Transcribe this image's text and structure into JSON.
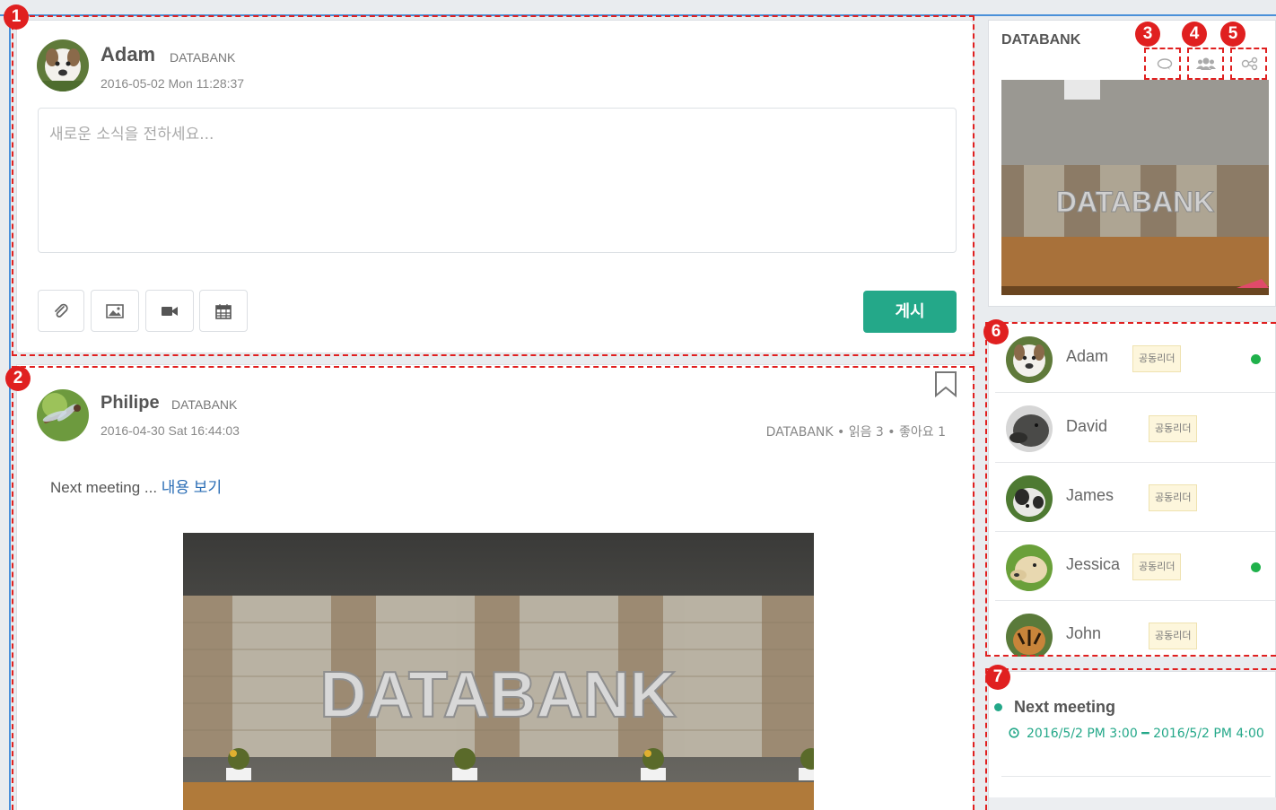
{
  "compose": {
    "user_name": "Adam",
    "org": "DATABANK",
    "datetime": "2016-05-02 Mon 11:28:37",
    "placeholder": "새로운 소식을 전하세요...",
    "tools": [
      "paperclip-icon",
      "image-icon",
      "video-camera-icon",
      "calendar-icon"
    ],
    "post_label": "게시"
  },
  "post": {
    "user_name": "Philipe",
    "org": "DATABANK",
    "datetime": "2016-04-30 Sat 16:44:03",
    "meta": "DATABANK • 읽음 3 • 좋아요 1",
    "body_text": "Next meeting ...",
    "read_more": "내용 보기",
    "image_sign_text": "DATABANK"
  },
  "group": {
    "title": "DATABANK",
    "icons": [
      "chat-bubble-icon",
      "members-icon",
      "share-icon"
    ],
    "image_sign_text": "DATABANK"
  },
  "members": [
    {
      "name": "Adam",
      "badge": "공동리더",
      "online": true
    },
    {
      "name": "David",
      "badge": "공동리더",
      "online": false
    },
    {
      "name": "James",
      "badge": "공동리더",
      "online": false
    },
    {
      "name": "Jessica",
      "badge": "공동리더",
      "online": true
    },
    {
      "name": "John",
      "badge": "공동리더",
      "online": false
    }
  ],
  "schedule": {
    "title": "Next meeting",
    "time_range": "2016/5/2 PM 3:00 ━ 2016/5/2 PM 4:00"
  },
  "annotations": [
    "1",
    "2",
    "3",
    "4",
    "5",
    "6",
    "7"
  ],
  "colors": {
    "accent": "#24a889",
    "annotation": "#e02020",
    "online": "#1fb14b",
    "link": "#2a6db5"
  }
}
